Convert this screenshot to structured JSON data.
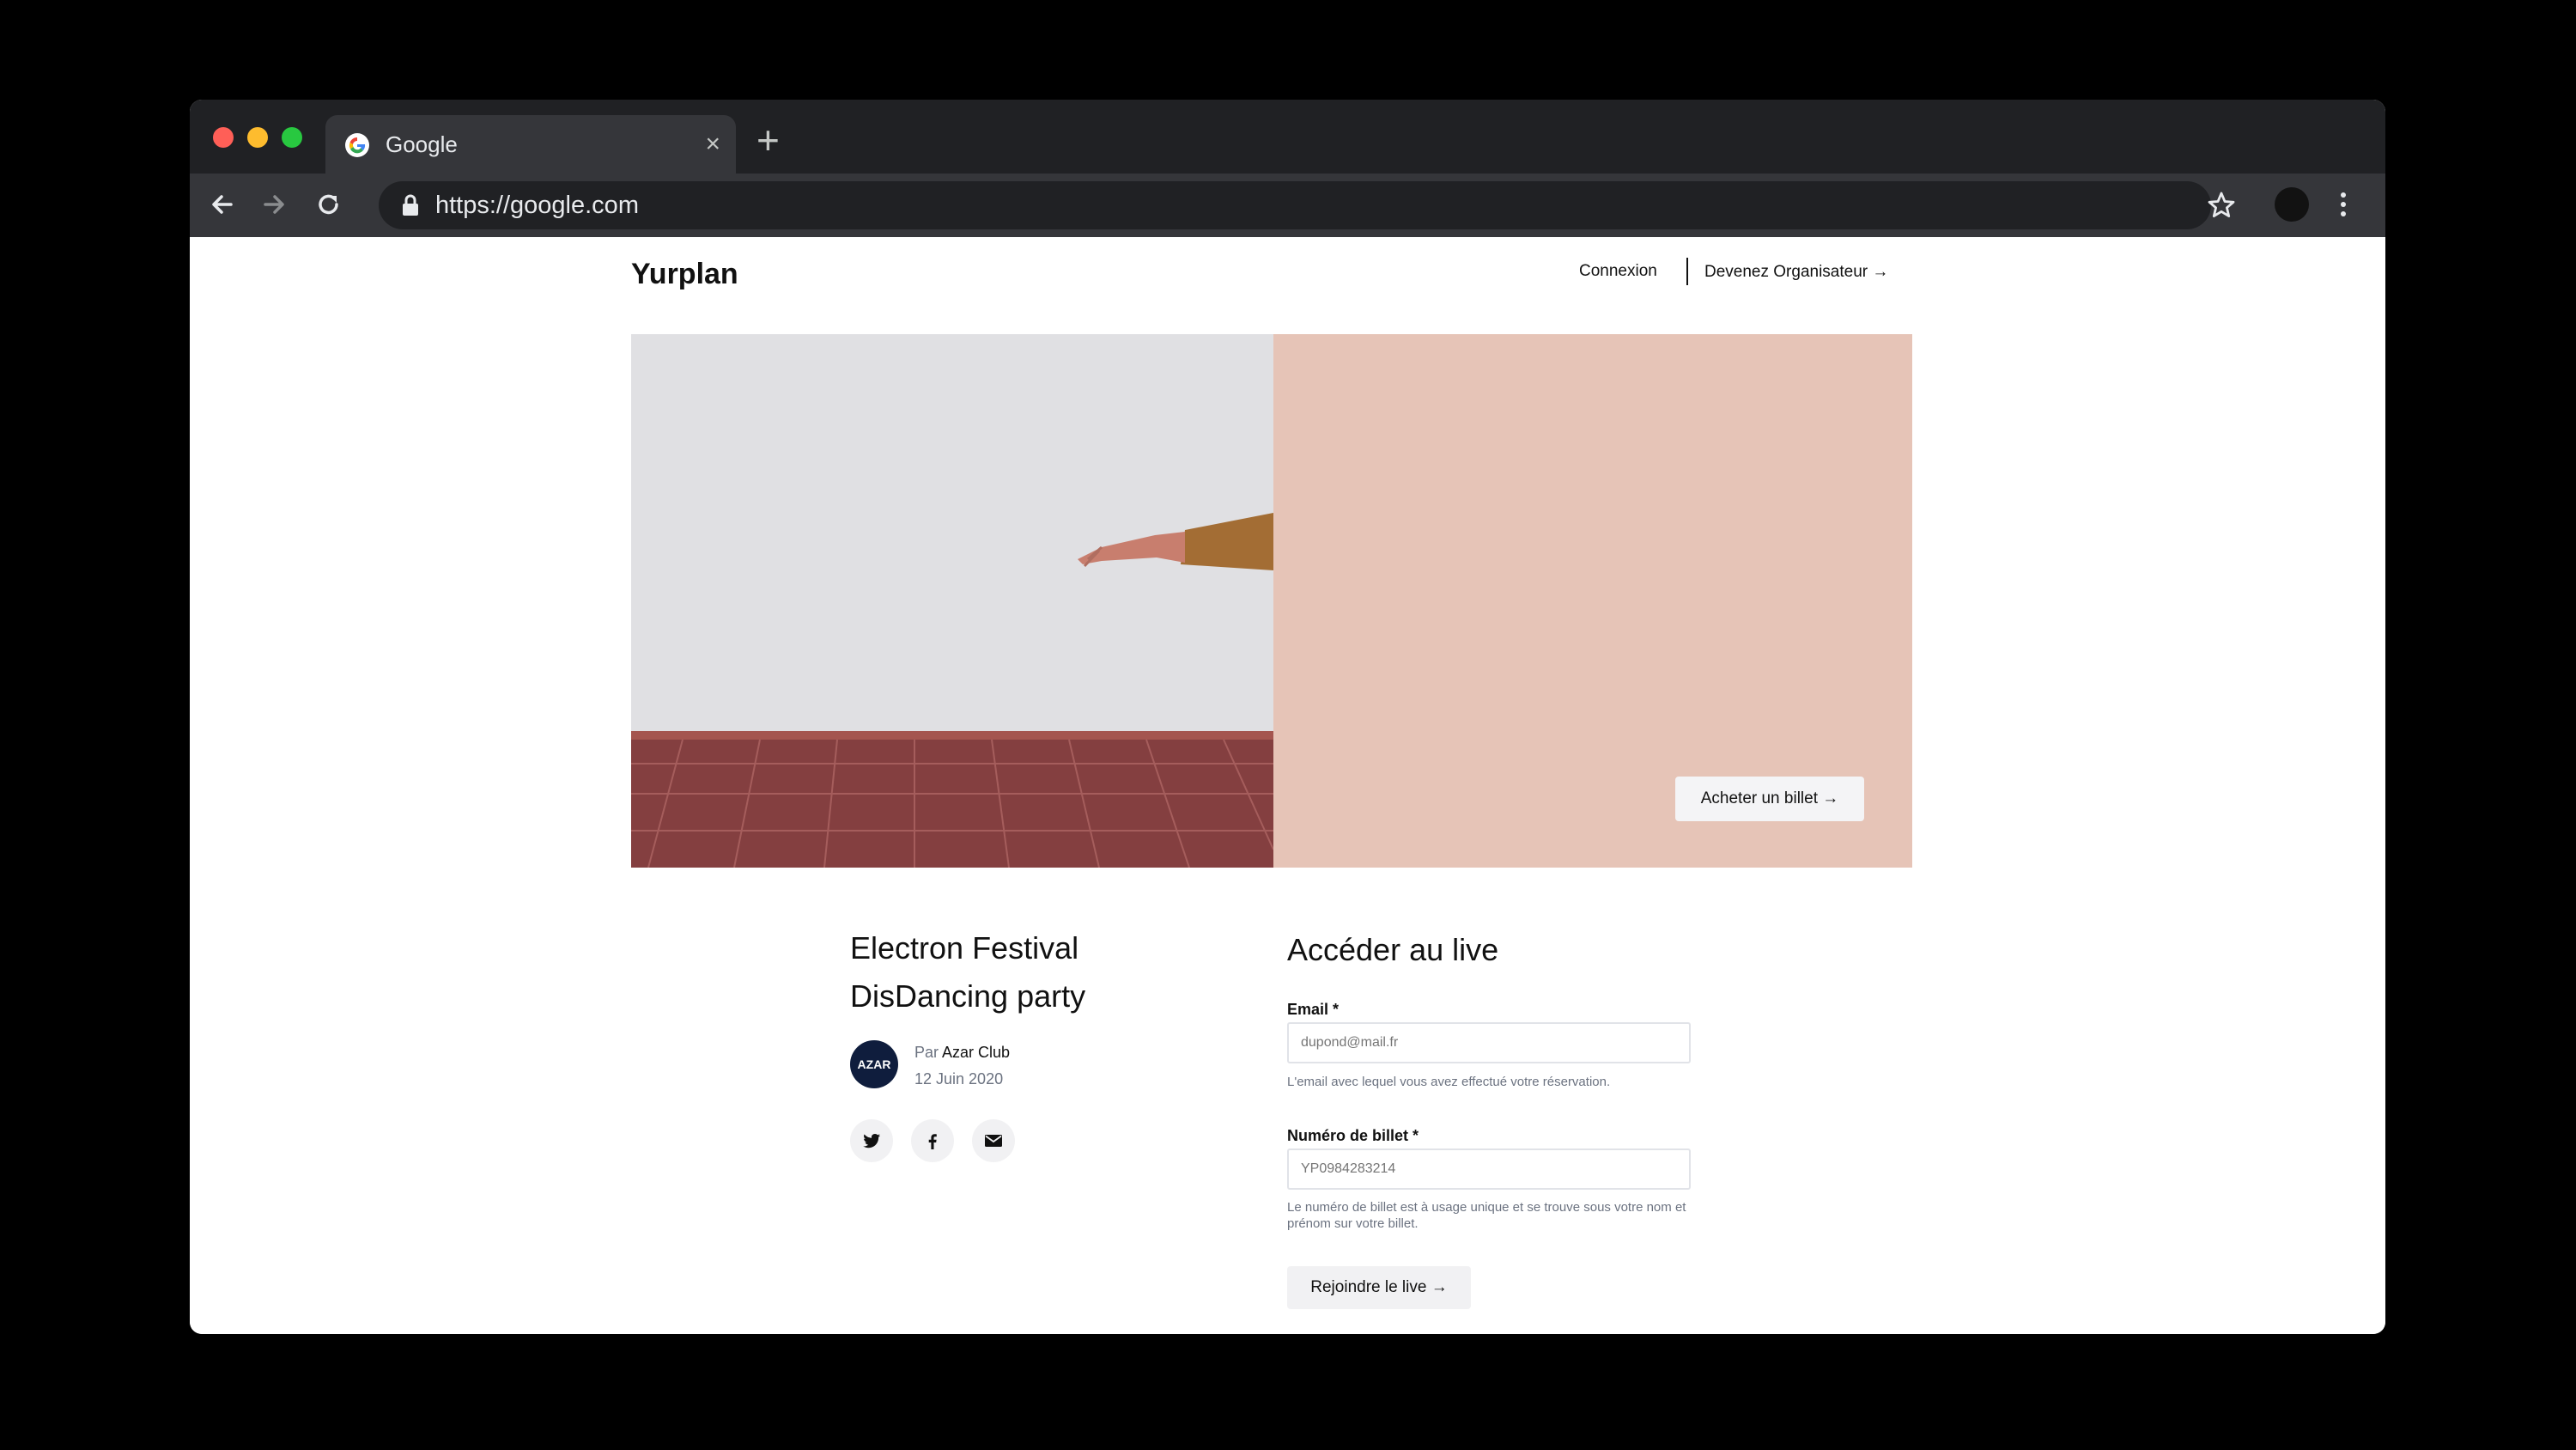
{
  "browser": {
    "tab_title": "Google",
    "tab_close": "×",
    "new_tab": "+",
    "url": "https://google.com"
  },
  "site": {
    "logo": "Yurplan",
    "nav": {
      "login": "Connexion",
      "organiser": "Devenez Organisateur →"
    }
  },
  "hero": {
    "buy_button": "Acheter un billet →"
  },
  "event": {
    "title": "Electron Festival DisDancing party",
    "organizer_avatar": "AZAR",
    "organizer_prefix": "Par",
    "organizer_name": "Azar Club",
    "date": "12 Juin 2020",
    "share_icons": [
      "twitter-icon",
      "facebook-icon",
      "mail-icon"
    ]
  },
  "form": {
    "title": "Accéder au live",
    "email": {
      "label": "Email *",
      "placeholder": "dupond@mail.fr",
      "help": "L'email avec lequel vous avez effectué votre réservation."
    },
    "ticket": {
      "label": "Numéro de billet *",
      "placeholder": "YP0984283214",
      "help": "Le numéro de billet est à usage unique et se trouve sous votre nom et prénom sur votre billet."
    },
    "submit": "Rejoindre le live →"
  },
  "colors": {
    "browser_chrome": "#202124",
    "toolbar": "#35363a",
    "hero_wall": "#e0e0e3",
    "hero_floor": "#8f4a4a",
    "hero_pink": "#e6c4b7",
    "avatar_navy": "#0f1d3d"
  }
}
